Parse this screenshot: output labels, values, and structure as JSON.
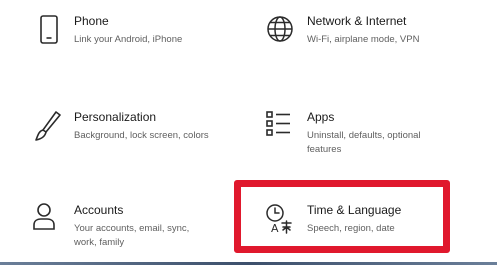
{
  "tiles": {
    "phone": {
      "title": "Phone",
      "description": "Link your Android, iPhone",
      "icon": "phone-icon"
    },
    "network": {
      "title": "Network & Internet",
      "description": "Wi-Fi, airplane mode, VPN",
      "icon": "globe-icon"
    },
    "personalization": {
      "title": "Personalization",
      "description": "Background, lock screen, colors",
      "icon": "brush-icon"
    },
    "apps": {
      "title": "Apps",
      "description": "Uninstall, defaults, optional features",
      "icon": "apps-list-icon"
    },
    "accounts": {
      "title": "Accounts",
      "description": "Your accounts, email, sync, work, family",
      "icon": "person-icon"
    },
    "time_language": {
      "title": "Time & Language",
      "description": "Speech, region, date",
      "icon": "time-language-icon"
    }
  },
  "colors": {
    "highlight": "#e0182d",
    "title": "#1a1a1a",
    "description": "#5f5f5f",
    "icon": "#2b2b2b"
  }
}
